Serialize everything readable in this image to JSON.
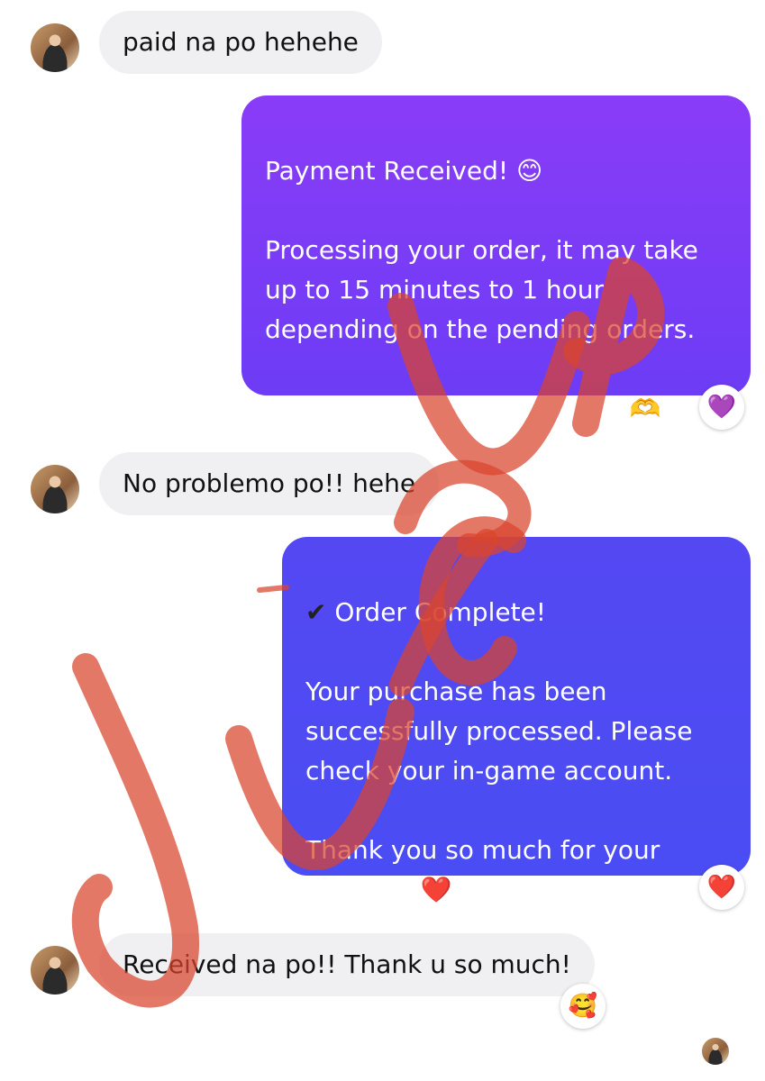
{
  "messages": [
    {
      "from": "customer",
      "text": "paid na po hehehe"
    },
    {
      "from": "shop",
      "text": "Payment Received! 😊\n\nProcessing your order, it may take up to 15 minutes to 1 hour depending on the pending orders.\n\nThank you for your patience 🫶"
    },
    {
      "from": "customer",
      "text": "No problemo po!! hehe"
    },
    {
      "from": "shop",
      "check": "✔",
      "text": " Order Complete!\n\nYour purchase has been successfully processed. Please check your in-game account.\n\nThank you so much for your support! ❤️"
    },
    {
      "from": "customer",
      "text": "Received na po!! Thank u so much!"
    }
  ],
  "reactions": {
    "payment_received": "💜",
    "order_complete": "❤️",
    "received": "🥰"
  },
  "colors": {
    "incoming_bubble": "#f0f0f2",
    "outgoing_purple": "#7b3cf6",
    "outgoing_blue": "#4e4bf3",
    "watermark": "#d9442c"
  }
}
